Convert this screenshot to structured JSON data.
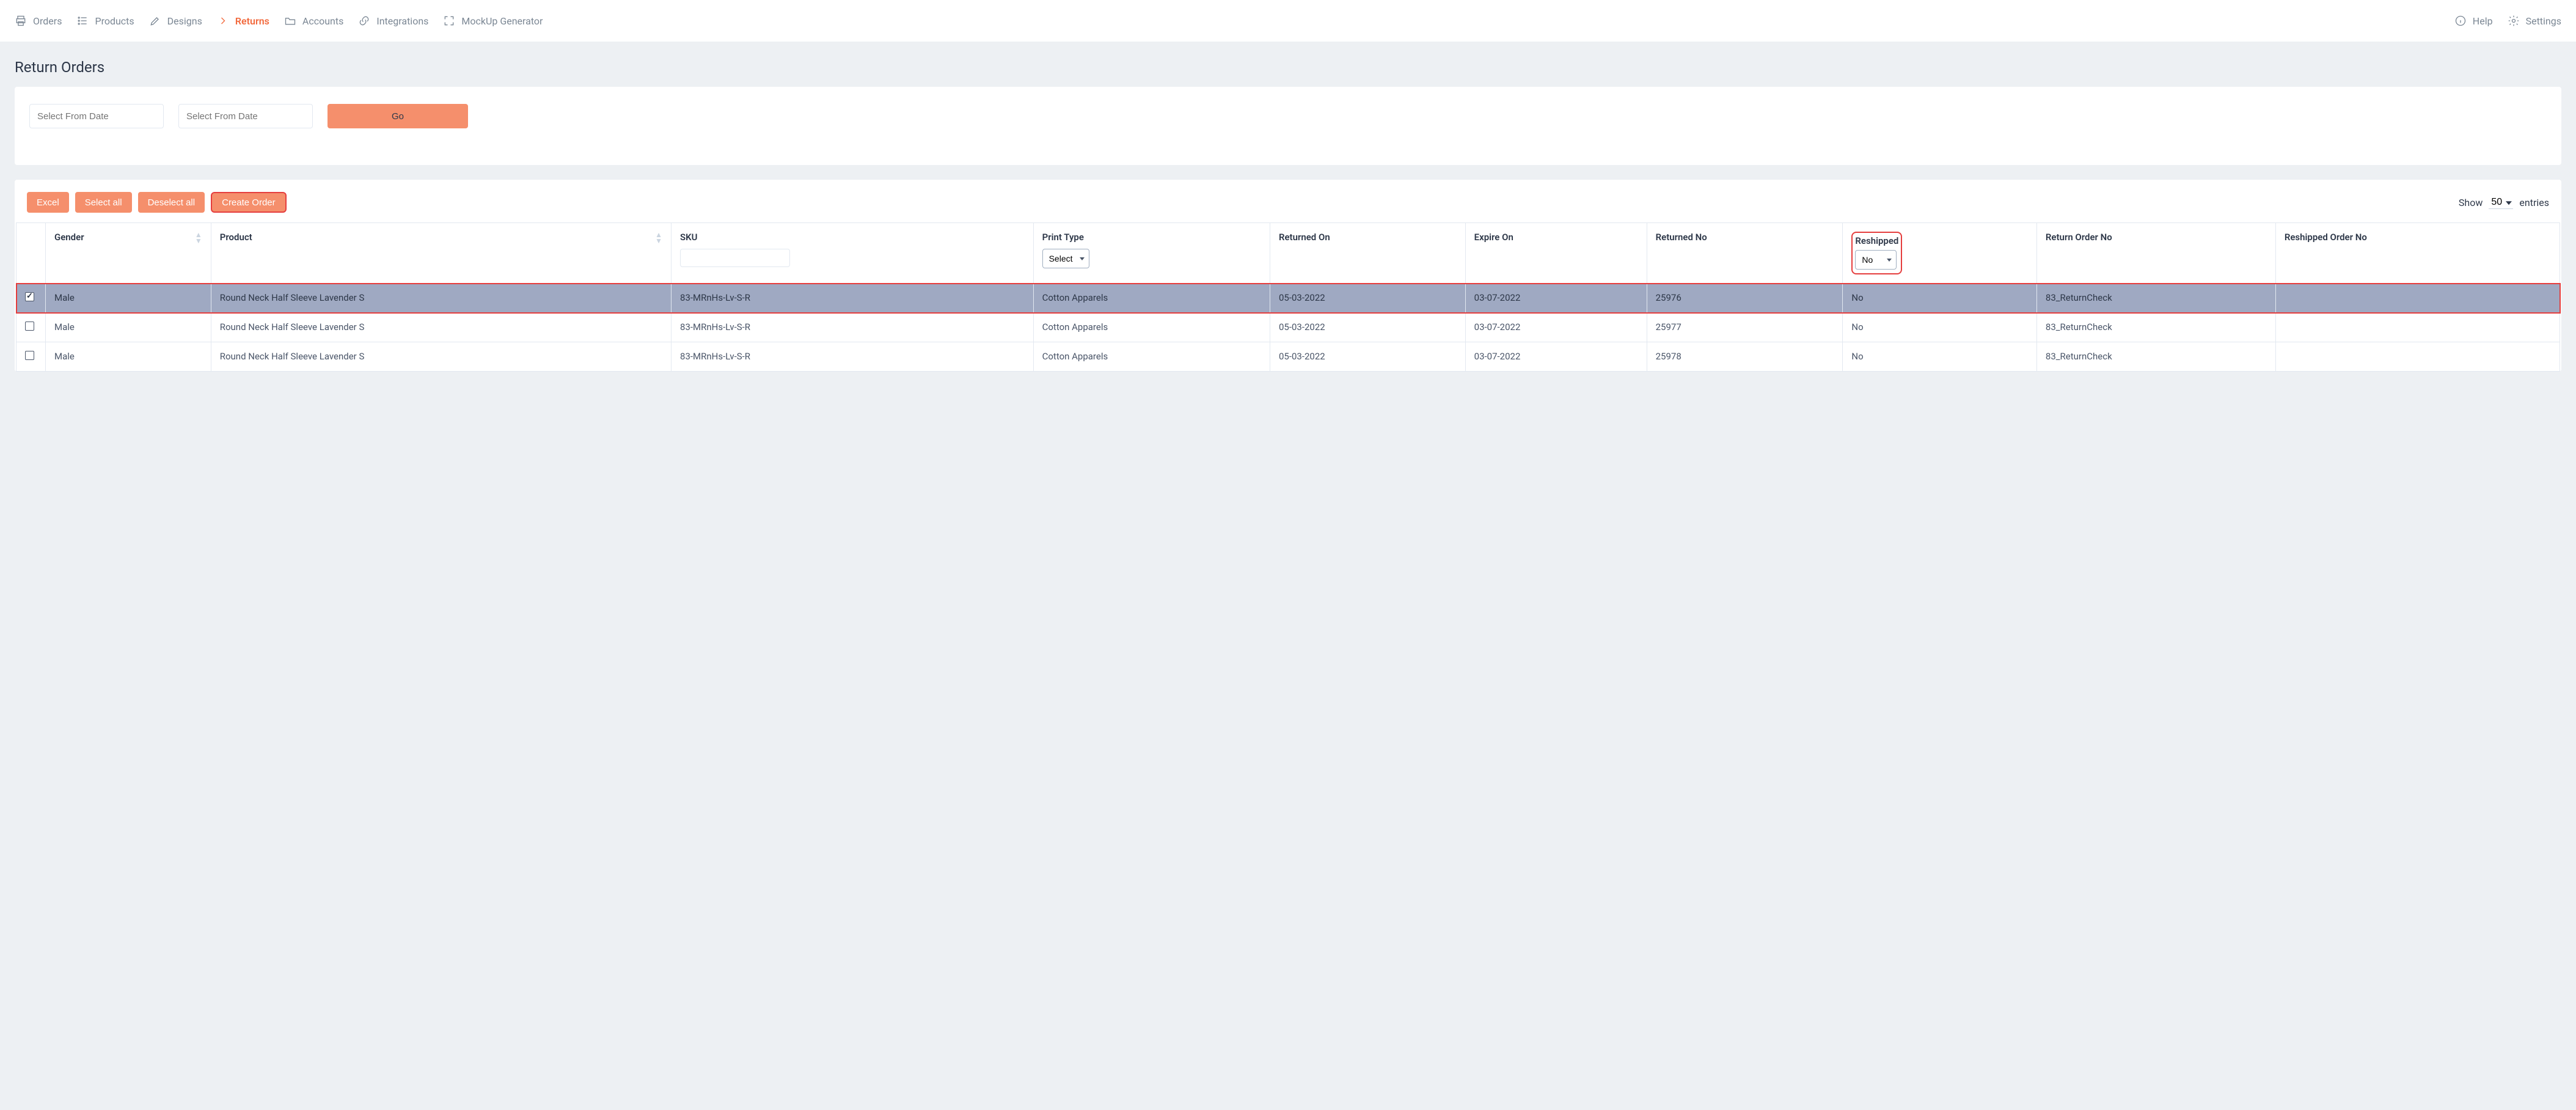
{
  "nav": {
    "items": [
      {
        "key": "orders",
        "label": "Orders"
      },
      {
        "key": "products",
        "label": "Products"
      },
      {
        "key": "designs",
        "label": "Designs"
      },
      {
        "key": "returns",
        "label": "Returns",
        "active": true
      },
      {
        "key": "accounts",
        "label": "Accounts"
      },
      {
        "key": "integrations",
        "label": "Integrations"
      },
      {
        "key": "mockup",
        "label": "MockUp Generator"
      }
    ],
    "help": "Help",
    "settings": "Settings"
  },
  "page": {
    "title": "Return Orders"
  },
  "filter": {
    "from_date_placeholder": "Select From Date",
    "to_date_placeholder": "Select From Date",
    "go_label": "Go"
  },
  "toolbar": {
    "excel": "Excel",
    "select_all": "Select all",
    "deselect_all": "Deselect all",
    "create_order": "Create Order",
    "show_label": "Show",
    "entries_label": "entries",
    "page_size": "50"
  },
  "table": {
    "headers": {
      "gender": "Gender",
      "product": "Product",
      "sku": "SKU",
      "print_type": "Print Type",
      "print_type_select": "Select",
      "returned_on": "Returned On",
      "expire_on": "Expire On",
      "returned_no": "Returned No",
      "reshipped": "Reshipped",
      "reshipped_select": "No",
      "return_order_no": "Return Order No",
      "reshipped_order_no": "Reshipped Order No"
    },
    "rows": [
      {
        "selected": true,
        "gender": "Male",
        "product": "Round Neck Half Sleeve Lavender S",
        "sku": "83-MRnHs-Lv-S-R",
        "print_type": "Cotton Apparels",
        "returned_on": "05-03-2022",
        "expire_on": "03-07-2022",
        "returned_no": "25976",
        "reshipped": "No",
        "return_order_no": "83_ReturnCheck",
        "reshipped_order_no": ""
      },
      {
        "selected": false,
        "gender": "Male",
        "product": "Round Neck Half Sleeve Lavender S",
        "sku": "83-MRnHs-Lv-S-R",
        "print_type": "Cotton Apparels",
        "returned_on": "05-03-2022",
        "expire_on": "03-07-2022",
        "returned_no": "25977",
        "reshipped": "No",
        "return_order_no": "83_ReturnCheck",
        "reshipped_order_no": ""
      },
      {
        "selected": false,
        "gender": "Male",
        "product": "Round Neck Half Sleeve Lavender S",
        "sku": "83-MRnHs-Lv-S-R",
        "print_type": "Cotton Apparels",
        "returned_on": "05-03-2022",
        "expire_on": "03-07-2022",
        "returned_no": "25978",
        "reshipped": "No",
        "return_order_no": "83_ReturnCheck",
        "reshipped_order_no": ""
      }
    ]
  }
}
